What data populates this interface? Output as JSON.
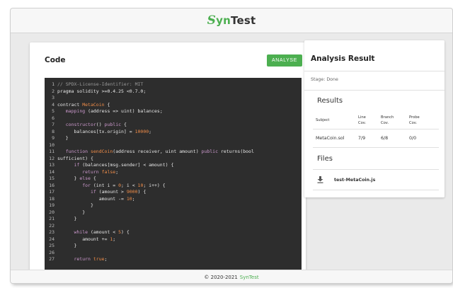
{
  "header": {
    "brand_s": "S",
    "brand_yn": "yn",
    "brand_rest": "Test"
  },
  "code_panel": {
    "title": "Code",
    "analyse_label": "ANALYSE"
  },
  "code_lines": [
    {
      "n": "1",
      "t": [
        [
          "cm",
          "// SPDX-License-Identifier: MIT"
        ]
      ]
    },
    {
      "n": "2",
      "t": [
        [
          "",
          "pragma solidity >=0.4.25 <0.7.0;"
        ]
      ]
    },
    {
      "n": "3",
      "t": [
        [
          "",
          ""
        ]
      ]
    },
    {
      "n": "4",
      "t": [
        [
          "",
          "contract "
        ],
        [
          "fn",
          "MetaCoin"
        ],
        [
          "",
          " {"
        ]
      ]
    },
    {
      "n": "5",
      "t": [
        [
          "",
          "   "
        ],
        [
          "kw",
          "mapping"
        ],
        [
          "",
          " (address => uint) balances;"
        ]
      ]
    },
    {
      "n": "6",
      "t": [
        [
          "",
          ""
        ]
      ]
    },
    {
      "n": "7",
      "t": [
        [
          "",
          "   "
        ],
        [
          "kw",
          "constructor"
        ],
        [
          "",
          "() "
        ],
        [
          "kw",
          "public"
        ],
        [
          "",
          " {"
        ]
      ]
    },
    {
      "n": "8",
      "t": [
        [
          "",
          "      balances[tx.origin] = "
        ],
        [
          "num",
          "10000"
        ],
        [
          "",
          ";"
        ]
      ]
    },
    {
      "n": "9",
      "t": [
        [
          "",
          "   }"
        ]
      ]
    },
    {
      "n": "10",
      "t": [
        [
          "",
          ""
        ]
      ]
    },
    {
      "n": "11",
      "t": [
        [
          "",
          "   "
        ],
        [
          "kw",
          "function"
        ],
        [
          "",
          " "
        ],
        [
          "fn",
          "sendCoin"
        ],
        [
          "",
          "(address receiver, uint amount) "
        ],
        [
          "kw",
          "public"
        ],
        [
          "",
          " returns(bool"
        ]
      ]
    },
    {
      "n": "12",
      "t": [
        [
          "",
          "sufficient) {"
        ]
      ]
    },
    {
      "n": "13",
      "t": [
        [
          "",
          "      "
        ],
        [
          "kw",
          "if"
        ],
        [
          "",
          " (balances[msg.sender] < amount) {"
        ]
      ]
    },
    {
      "n": "14",
      "t": [
        [
          "",
          "         "
        ],
        [
          "kw",
          "return"
        ],
        [
          "",
          " "
        ],
        [
          "num",
          "false"
        ],
        [
          "",
          ";"
        ]
      ]
    },
    {
      "n": "15",
      "t": [
        [
          "",
          "      } "
        ],
        [
          "kw",
          "else"
        ],
        [
          "",
          " {"
        ]
      ]
    },
    {
      "n": "16",
      "t": [
        [
          "",
          "         "
        ],
        [
          "kw",
          "for"
        ],
        [
          "",
          " (int i = "
        ],
        [
          "num",
          "0"
        ],
        [
          "",
          "; i < "
        ],
        [
          "num",
          "10"
        ],
        [
          "",
          "; i++) {"
        ]
      ]
    },
    {
      "n": "17",
      "t": [
        [
          "",
          "            "
        ],
        [
          "kw",
          "if"
        ],
        [
          "",
          " (amount > "
        ],
        [
          "num",
          "9000"
        ],
        [
          "",
          ") {"
        ]
      ]
    },
    {
      "n": "18",
      "t": [
        [
          "",
          "               amount -= "
        ],
        [
          "num",
          "10"
        ],
        [
          "",
          ";"
        ]
      ]
    },
    {
      "n": "19",
      "t": [
        [
          "",
          "            }"
        ]
      ]
    },
    {
      "n": "20",
      "t": [
        [
          "",
          "         }"
        ]
      ]
    },
    {
      "n": "21",
      "t": [
        [
          "",
          "      }"
        ]
      ]
    },
    {
      "n": "22",
      "t": [
        [
          "",
          ""
        ]
      ]
    },
    {
      "n": "23",
      "t": [
        [
          "",
          "      "
        ],
        [
          "kw",
          "while"
        ],
        [
          "",
          " (amount < "
        ],
        [
          "num",
          "5"
        ],
        [
          "",
          ") {"
        ]
      ]
    },
    {
      "n": "24",
      "t": [
        [
          "",
          "         amount += "
        ],
        [
          "num",
          "1"
        ],
        [
          "",
          ";"
        ]
      ]
    },
    {
      "n": "25",
      "t": [
        [
          "",
          "      }"
        ]
      ]
    },
    {
      "n": "26",
      "t": [
        [
          "",
          ""
        ]
      ]
    },
    {
      "n": "27",
      "t": [
        [
          "",
          "      "
        ],
        [
          "kw",
          "return"
        ],
        [
          "",
          " "
        ],
        [
          "num",
          "true"
        ],
        [
          "",
          ";"
        ]
      ]
    }
  ],
  "analysis": {
    "title": "Analysis Result",
    "stage": "Stage: Done",
    "results_heading": "Results",
    "columns": [
      "Subject",
      "Line\nCov.",
      "Branch\nCov.",
      "Probe\nCov."
    ],
    "rows": [
      [
        "MetaCoin.sol",
        "7/9",
        "6/8",
        "0/0"
      ]
    ],
    "files_heading": "Files",
    "files": [
      {
        "name": "test-MetaCoin.js",
        "icon": "download-icon"
      }
    ]
  },
  "footer": {
    "copyright": "© 2020-2021",
    "link": "SynTest"
  },
  "colors": {
    "accent": "#4caf50",
    "code_bg": "#2d2d2d"
  }
}
